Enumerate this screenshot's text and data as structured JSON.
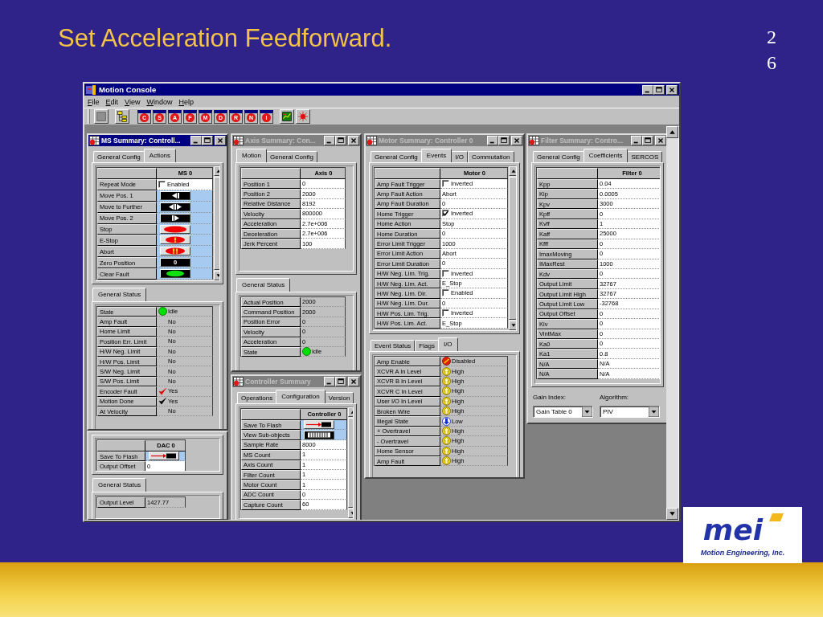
{
  "slide": {
    "title": "Set Acceleration Feedforward.",
    "page_number": "26",
    "logo_text": "mei",
    "company": "Motion Engineering, Inc."
  },
  "app": {
    "title": "Motion Console",
    "menu": [
      "File",
      "Edit",
      "View",
      "Window",
      "Help"
    ],
    "toolbar_letters": [
      "C",
      "S",
      "A",
      "F",
      "M",
      "D",
      "R",
      "N",
      "I"
    ]
  },
  "windows": [
    {
      "title": "MS Summary:  Controll...",
      "active": true,
      "tabs": [
        {
          "label": "General Config",
          "selected": false
        },
        {
          "label": "Actions",
          "selected": true
        }
      ],
      "grid": {
        "header": "MS 0",
        "rows": [
          {
            "label": "Repeat Mode",
            "kind": "checkbox",
            "checked": false,
            "value": "Enabled"
          },
          {
            "label": "Move Pos. 1",
            "kind": "left"
          },
          {
            "label": "Move to Further",
            "kind": "both"
          },
          {
            "label": "Move Pos. 2",
            "kind": "right"
          },
          {
            "label": "Stop",
            "kind": "stop"
          },
          {
            "label": "E-Stop",
            "kind": "estop"
          },
          {
            "label": "Abort",
            "kind": "abort"
          },
          {
            "label": "Zero Position",
            "kind": "zero",
            "value": "0"
          },
          {
            "label": "Clear Fault",
            "kind": "clear"
          }
        ]
      },
      "status": {
        "tabs": [
          {
            "label": "General Status",
            "selected": true
          }
        ],
        "rows": [
          {
            "label": "State",
            "kind": "led",
            "color": "#00e000",
            "value": "Idle"
          },
          {
            "label": "Amp Fault",
            "kind": "status",
            "value": "No"
          },
          {
            "label": "Home Limit",
            "kind": "status",
            "value": "No"
          },
          {
            "label": "Position Err. Limit",
            "kind": "status",
            "value": "No"
          },
          {
            "label": "H/W Neg. Limit",
            "kind": "status",
            "value": "No"
          },
          {
            "label": "H/W Pos. Limit",
            "kind": "status",
            "value": "No"
          },
          {
            "label": "S/W Neg. Limit",
            "kind": "status",
            "value": "No"
          },
          {
            "label": "S/W Pos. Limit",
            "kind": "status",
            "value": "No"
          },
          {
            "label": "Encoder Fault",
            "kind": "tick",
            "color": "#e00000",
            "value": "Yes"
          },
          {
            "label": "Motion Done",
            "kind": "tick",
            "color": "#000000",
            "value": "Yes"
          },
          {
            "label": "At Velocity",
            "kind": "status",
            "value": "No"
          }
        ]
      }
    },
    {
      "grid": {
        "header": "DAC 0",
        "rows": [
          {
            "label": "Save To Flash",
            "kind": "flash"
          },
          {
            "label": "Output Offset",
            "kind": "text",
            "value": "0"
          }
        ]
      },
      "status": {
        "tabs": [
          {
            "label": "General Status",
            "selected": true
          }
        ],
        "rows": [
          {
            "label": "Output Level",
            "kind": "status",
            "value": "1427.77"
          }
        ]
      }
    },
    {
      "title": "Axis Summary:  Con...",
      "active": false,
      "tabs": [
        {
          "label": "Motion",
          "selected": true
        },
        {
          "label": "General Config",
          "selected": false
        }
      ],
      "grid": {
        "header": "Axis 0",
        "rows": [
          {
            "label": "Position 1",
            "kind": "text",
            "value": "0"
          },
          {
            "label": "Position 2",
            "kind": "text",
            "value": "2000"
          },
          {
            "label": "Relative Distance",
            "kind": "text",
            "value": "8192"
          },
          {
            "label": "Velocity",
            "kind": "text",
            "value": "800000"
          },
          {
            "label": "Acceleration",
            "kind": "text",
            "value": "2.7e+006"
          },
          {
            "label": "Deceleration",
            "kind": "text",
            "value": "2.7e+006"
          },
          {
            "label": "Jerk Percent",
            "kind": "text",
            "value": "100"
          }
        ]
      },
      "status": {
        "tabs": [
          {
            "label": "General Status",
            "selected": true
          }
        ],
        "rows": [
          {
            "label": "Actual Position",
            "kind": "status",
            "value": "2000"
          },
          {
            "label": "Command Position",
            "kind": "status",
            "value": "2000"
          },
          {
            "label": "Position Error",
            "kind": "status",
            "value": "0"
          },
          {
            "label": "Velocity",
            "kind": "status",
            "value": "0"
          },
          {
            "label": "Acceleration",
            "kind": "status",
            "value": "0"
          },
          {
            "label": "State",
            "kind": "led",
            "color": "#00e000",
            "value": "Idle"
          }
        ]
      }
    },
    {
      "title": "Controller Summary",
      "active": false,
      "tabs": [
        {
          "label": "Operations",
          "selected": false
        },
        {
          "label": "Configuration",
          "selected": true
        },
        {
          "label": "Version",
          "selected": false
        }
      ],
      "grid": {
        "header": "Controller 0",
        "rows": [
          {
            "label": "Save To Flash",
            "kind": "flash"
          },
          {
            "label": "View Sub-objects",
            "kind": "subobjects"
          },
          {
            "label": "Sample Rate",
            "kind": "text",
            "value": "8000"
          },
          {
            "label": "MS Count",
            "kind": "text",
            "value": "1"
          },
          {
            "label": "Axis Count",
            "kind": "text",
            "value": "1"
          },
          {
            "label": "Filter Count",
            "kind": "text",
            "value": "1"
          },
          {
            "label": "Motor Count",
            "kind": "text",
            "value": "1"
          },
          {
            "label": "ADC Count",
            "kind": "text",
            "value": "0"
          },
          {
            "label": "Capture Count",
            "kind": "text",
            "value": "60"
          }
        ]
      }
    },
    {
      "title": "Motor Summary:  Controller 0",
      "active": false,
      "tabs": [
        {
          "label": "General Config",
          "selected": false
        },
        {
          "label": "Events",
          "selected": true
        },
        {
          "label": "I/O",
          "selected": false
        },
        {
          "label": "Commutation",
          "selected": false
        }
      ],
      "grid": {
        "header": "Motor 0",
        "rows": [
          {
            "label": "Amp Fault Trigger",
            "kind": "checkbox",
            "checked": false,
            "value": "Inverted"
          },
          {
            "label": "Amp Fault Action",
            "kind": "text",
            "value": "Abort"
          },
          {
            "label": "Amp Fault Duration",
            "kind": "text",
            "value": "0"
          },
          {
            "label": "Home Trigger",
            "kind": "checkbox",
            "checked": true,
            "value": "Inverted"
          },
          {
            "label": "Home Action",
            "kind": "text",
            "value": "Stop"
          },
          {
            "label": "Home Duration",
            "kind": "text",
            "value": "0"
          },
          {
            "label": "Error Limit Trigger",
            "kind": "text",
            "value": "1000"
          },
          {
            "label": "Error Limit Action",
            "kind": "text",
            "value": "Abort"
          },
          {
            "label": "Error Limit Duration",
            "kind": "text",
            "value": "0"
          },
          {
            "label": "H/W Neg. Lim. Trig.",
            "kind": "checkbox",
            "checked": false,
            "value": "Inverted"
          },
          {
            "label": "H/W Neg. Lim. Act.",
            "kind": "text",
            "value": "E_Stop"
          },
          {
            "label": "H/W Neg. Lim. Dir.",
            "kind": "checkbox",
            "checked": false,
            "value": "Enabled"
          },
          {
            "label": "H/W Neg. Lim. Dur.",
            "kind": "text",
            "value": "0"
          },
          {
            "label": "H/W Pos. Lim. Trig.",
            "kind": "checkbox",
            "checked": false,
            "value": "Inverted"
          },
          {
            "label": "H/W Pos. Lim. Act.",
            "kind": "text",
            "value": "E_Stop"
          }
        ]
      },
      "status": {
        "tabs": [
          {
            "label": "Event Status",
            "selected": false
          },
          {
            "label": "Flags",
            "selected": false
          },
          {
            "label": "I/O",
            "selected": true
          }
        ],
        "rows": [
          {
            "label": "Amp Enable",
            "kind": "off",
            "value": "Disabled"
          },
          {
            "label": "XCVR A In Level",
            "kind": "up",
            "value": "High"
          },
          {
            "label": "XCVR B In Level",
            "kind": "up",
            "value": "High"
          },
          {
            "label": "XCVR C In Level",
            "kind": "up",
            "value": "High"
          },
          {
            "label": "User I/O In Level",
            "kind": "up",
            "value": "High"
          },
          {
            "label": "Broken Wire",
            "kind": "up",
            "value": "High"
          },
          {
            "label": "Illegal State",
            "kind": "down",
            "value": "Low"
          },
          {
            "label": "+ Overtravel",
            "kind": "up",
            "value": "High"
          },
          {
            "label": "- Overtravel",
            "kind": "up",
            "value": "High"
          },
          {
            "label": "Home Sensor",
            "kind": "up",
            "value": "High"
          },
          {
            "label": "Amp Fault",
            "kind": "up",
            "value": "High"
          }
        ]
      }
    },
    {
      "title": "Filter Summary:  Contro...",
      "active": false,
      "tabs": [
        {
          "label": "General Config",
          "selected": false
        },
        {
          "label": "Coefficients",
          "selected": true
        },
        {
          "label": "SERCOS",
          "selected": false
        }
      ],
      "grid": {
        "header": "Filter 0",
        "rows": [
          {
            "label": "Kpp",
            "kind": "text",
            "value": "0.04"
          },
          {
            "label": "Kip",
            "kind": "text",
            "value": "0.0005"
          },
          {
            "label": "Kpv",
            "kind": "text",
            "value": "3000"
          },
          {
            "label": "Kpff",
            "kind": "text",
            "value": "0"
          },
          {
            "label": "Kvff",
            "kind": "text",
            "value": "1"
          },
          {
            "label": "Kaff",
            "kind": "text",
            "value": "25000"
          },
          {
            "label": "Kfff",
            "kind": "text",
            "value": "0"
          },
          {
            "label": "ImaxMoving",
            "kind": "text",
            "value": "0"
          },
          {
            "label": "IMaxRest",
            "kind": "text",
            "value": "1000"
          },
          {
            "label": "Kdv",
            "kind": "text",
            "value": "0"
          },
          {
            "label": "Output Limit",
            "kind": "text",
            "value": "32767"
          },
          {
            "label": "Output Limit High",
            "kind": "text",
            "value": "32767"
          },
          {
            "label": "Output Limit Low",
            "kind": "text",
            "value": "-32768"
          },
          {
            "label": "Output Offset",
            "kind": "text",
            "value": "0"
          },
          {
            "label": "Kiv",
            "kind": "text",
            "value": "0"
          },
          {
            "label": "VintMax",
            "kind": "text",
            "value": "0"
          },
          {
            "label": "Ka0",
            "kind": "text",
            "value": "0"
          },
          {
            "label": "Ka1",
            "kind": "text",
            "value": "0.8"
          },
          {
            "label": "N/A",
            "kind": "text",
            "value": "N/A"
          },
          {
            "label": "N/A",
            "kind": "text",
            "value": "N/A"
          }
        ]
      },
      "footer": {
        "gain_label": "Gain Index:",
        "gain_value": "Gain Table 0",
        "algorithm_label": "Algorithm:",
        "algorithm_value": "PIV"
      }
    }
  ]
}
